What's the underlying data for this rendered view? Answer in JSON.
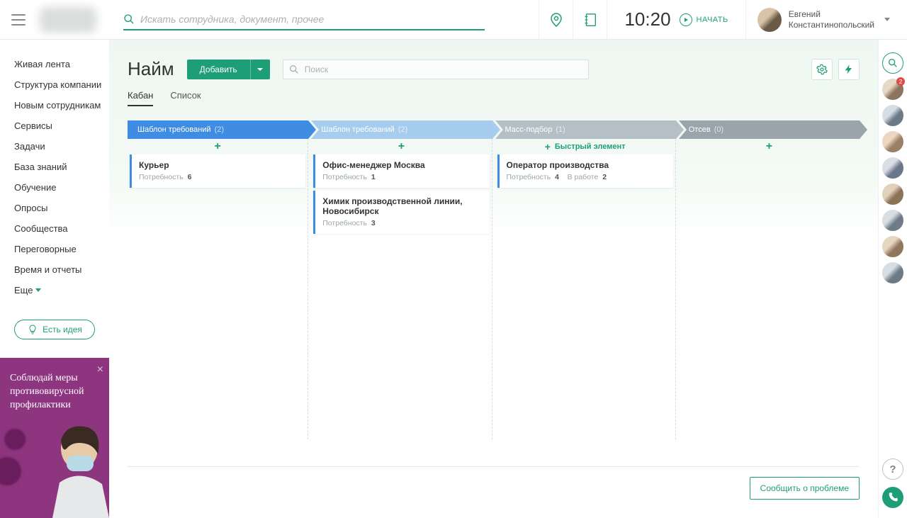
{
  "header": {
    "search_placeholder": "Искать сотрудника, документ, прочее",
    "time": "10:20",
    "start_label": "НАЧАТЬ",
    "user_first": "Евгений",
    "user_last": "Константинопольский"
  },
  "sidebar": {
    "items": [
      "Живая лента",
      "Структура компании",
      "Новым сотрудникам",
      "Сервисы",
      "Задачи",
      "База знаний",
      "Обучение",
      "Опросы",
      "Сообщества",
      "Переговорные",
      "Время и отчеты"
    ],
    "more": "Еще",
    "idea": "Есть идея"
  },
  "promo": {
    "text": "Соблюдай меры противовирусной профилактики"
  },
  "page": {
    "title": "Найм",
    "add": "Добавить",
    "search_placeholder": "Поиск",
    "tabs": {
      "kanban": "Кабан",
      "list": "Список"
    }
  },
  "columns": [
    {
      "title": "Шаблон требований",
      "count": "(2)",
      "quick": "+",
      "variant": "h1"
    },
    {
      "title": "Шаблон требований",
      "count": "(2)",
      "quick": "+",
      "variant": "h2"
    },
    {
      "title": "Масс-подбор",
      "count": "(1)",
      "quick_label": "Быстрый элемент",
      "variant": "h3"
    },
    {
      "title": "Отсев",
      "count": "(0)",
      "quick": "+",
      "variant": "h4"
    }
  ],
  "cards": {
    "c0": [
      {
        "title": "Курьер",
        "need_label": "Потребность",
        "need": "6"
      }
    ],
    "c1": [
      {
        "title": "Офис-менеджер Москва",
        "need_label": "Потребность",
        "need": "1"
      },
      {
        "title": "Химик производственной линии, Новосибирск",
        "need_label": "Потребность",
        "need": "3"
      }
    ],
    "c2": [
      {
        "title": "Оператор производства",
        "need_label": "Потребность",
        "need": "4",
        "work_label": "В работе",
        "work": "2"
      }
    ],
    "c3": []
  },
  "footer": {
    "report": "Сообщить о проблеме"
  },
  "rail": {
    "badge": "2"
  }
}
